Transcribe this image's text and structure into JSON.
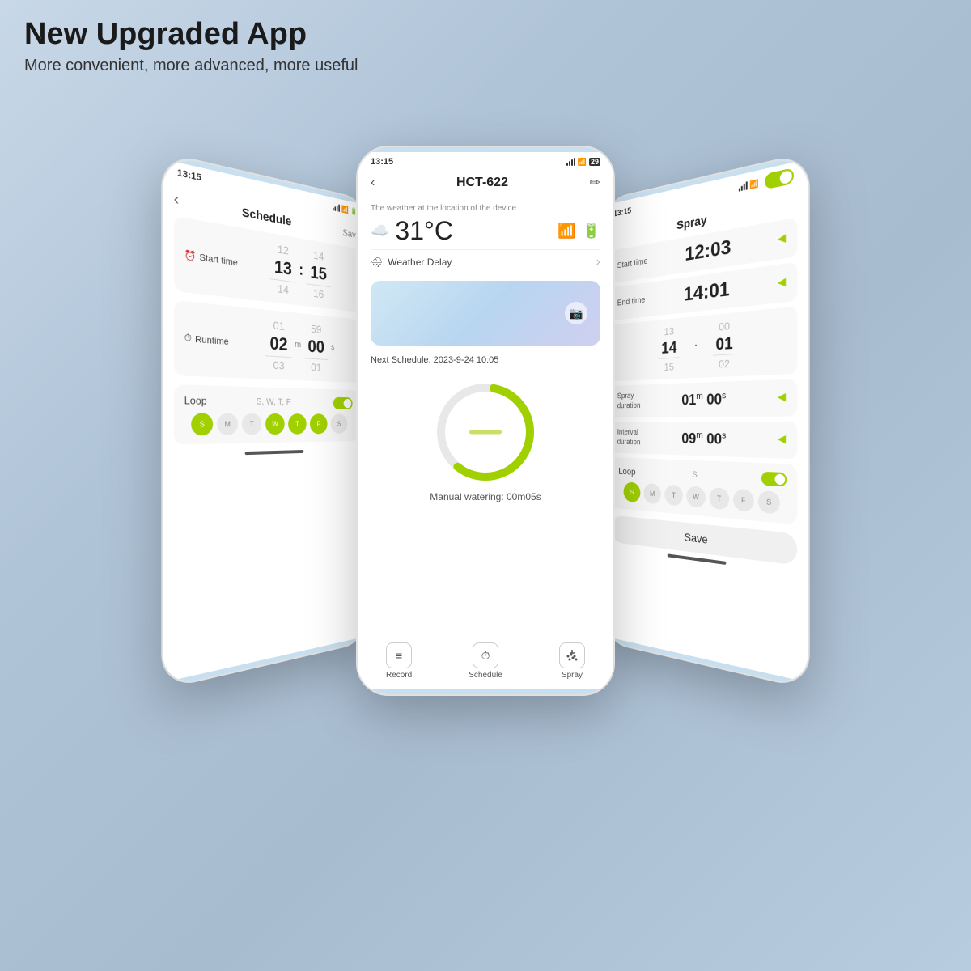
{
  "header": {
    "title": "New Upgraded App",
    "subtitle": "More convenient, more advanced, more useful"
  },
  "center_phone": {
    "status_time": "13:15",
    "nav_title": "HCT-622",
    "back_icon": "‹",
    "edit_icon": "✏",
    "weather_subtitle": "The weather at the location of the device",
    "temperature": "31°C",
    "weather_delay": "Weather Delay",
    "next_schedule": "Next Schedule:  2023-9-24 10:05",
    "manual_watering": "Manual watering: 00m05s",
    "bottom_nav": [
      {
        "label": "Record",
        "icon": "≡"
      },
      {
        "label": "Schedule",
        "icon": "⏱"
      },
      {
        "label": "Spray",
        "icon": "⋯"
      }
    ]
  },
  "left_phone": {
    "status_time": "13:15",
    "title": "Schedule",
    "save_label": "Save",
    "start_time_label": "Start time",
    "start_time_top": "12",
    "start_time_main_h": "13",
    "start_time_bot_h": "14",
    "start_time_top_m": "14",
    "start_time_main_m": "15",
    "start_time_bot_m": "16",
    "runtime_label": "Runtime",
    "runtime_top_h": "01",
    "runtime_main_h": "02",
    "runtime_bot_h": "03",
    "runtime_unit_h": "m",
    "runtime_top_s": "59",
    "runtime_main_s": "00",
    "runtime_bot_s": "01",
    "runtime_unit_s": "s",
    "loop_label": "Loop",
    "loop_days_text": "S, W, T, F",
    "days": [
      "S",
      "M",
      "T",
      "W",
      "T",
      "F",
      "S"
    ],
    "active_days": [
      0,
      3,
      4,
      5
    ]
  },
  "right_phone": {
    "status_time": "13:15",
    "title": "Spray",
    "back_icon": "‹",
    "start_time_label": "Start time",
    "start_time": "12:03",
    "end_time_label": "End time",
    "end_time": "14:01",
    "picker_row_1": [
      "13",
      "00"
    ],
    "picker_row_2": [
      "14",
      "01"
    ],
    "picker_row_3": [
      "15",
      "02"
    ],
    "spray_duration_label": "Spray\nduration",
    "spray_duration": "01m 00s",
    "interval_label": "Interval\nduration",
    "interval_duration": "09m 00s",
    "loop_label": "Loop",
    "loop_day": "S",
    "days": [
      "S",
      "M",
      "T",
      "W",
      "T",
      "F",
      "S"
    ],
    "active_days": [
      0
    ],
    "save_label": "Save"
  }
}
